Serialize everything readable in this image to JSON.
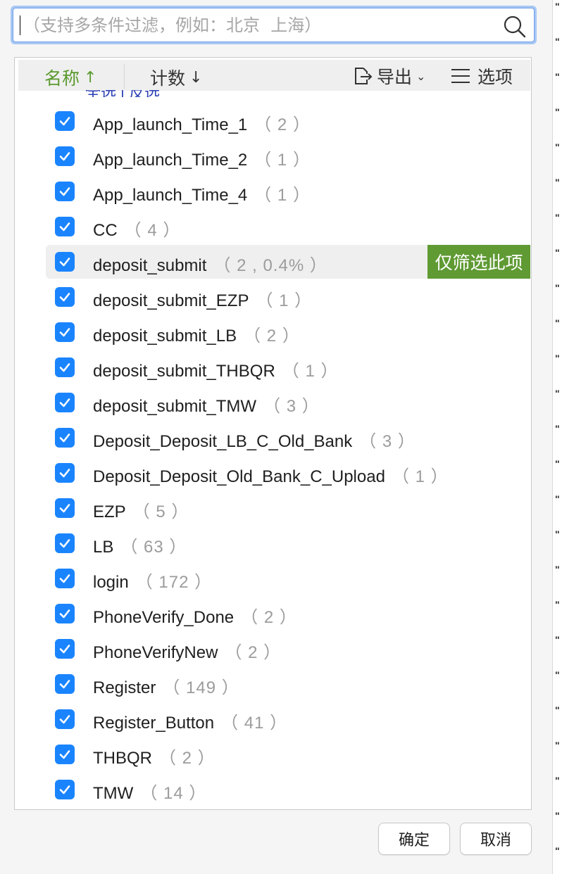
{
  "search": {
    "placeholder": "（支持多条件过滤，例如：北京  上海）",
    "value": ""
  },
  "toolbar": {
    "name_label": "名称",
    "name_arrow": "↑",
    "count_label": "计数",
    "count_arrow": "↓",
    "export_label": "导出",
    "options_label": "选项"
  },
  "partial_row_text": "全选 | 反选",
  "items": [
    {
      "label": "App_launch_Time_1",
      "count": "（ 2 ）",
      "checked": true
    },
    {
      "label": "App_launch_Time_2",
      "count": "（ 1 ）",
      "checked": true
    },
    {
      "label": "App_launch_Time_4",
      "count": "（ 1 ）",
      "checked": true
    },
    {
      "label": "CC",
      "count": "（ 4 ）",
      "checked": true
    },
    {
      "label": "deposit_submit",
      "count": "（ 2 , 0.4% ）",
      "checked": true,
      "hovered": true
    },
    {
      "label": "deposit_submit_EZP",
      "count": "（ 1 ）",
      "checked": true
    },
    {
      "label": "deposit_submit_LB",
      "count": "（ 2 ）",
      "checked": true
    },
    {
      "label": "deposit_submit_THBQR",
      "count": "（ 1 ）",
      "checked": true
    },
    {
      "label": "deposit_submit_TMW",
      "count": "（ 3 ）",
      "checked": true
    },
    {
      "label": "Deposit_Deposit_LB_C_Old_Bank",
      "count": "（ 3 ）",
      "checked": true
    },
    {
      "label": "Deposit_Deposit_Old_Bank_C_Upload",
      "count": "（ 1 ）",
      "checked": true
    },
    {
      "label": "EZP",
      "count": "（ 5 ）",
      "checked": true
    },
    {
      "label": "LB",
      "count": "（ 63 ）",
      "checked": true
    },
    {
      "label": "login",
      "count": "（ 172 ）",
      "checked": true
    },
    {
      "label": "PhoneVerify_Done",
      "count": "（ 2 ）",
      "checked": true
    },
    {
      "label": "PhoneVerifyNew",
      "count": "（ 2 ）",
      "checked": true
    },
    {
      "label": "Register",
      "count": "（ 149 ）",
      "checked": true
    },
    {
      "label": "Register_Button",
      "count": "（ 41 ）",
      "checked": true
    },
    {
      "label": "THBQR",
      "count": "（ 2 ）",
      "checked": true
    },
    {
      "label": "TMW",
      "count": "（ 14 ）",
      "checked": true
    }
  ],
  "only_this_label": "仅筛选此项",
  "buttons": {
    "ok": "确定",
    "cancel": "取消"
  },
  "colors": {
    "accent_green": "#5f9a33",
    "checkbox_blue": "#1a84ff",
    "focus_ring": "#a8c8f4"
  },
  "background_strip_glyph": "\""
}
